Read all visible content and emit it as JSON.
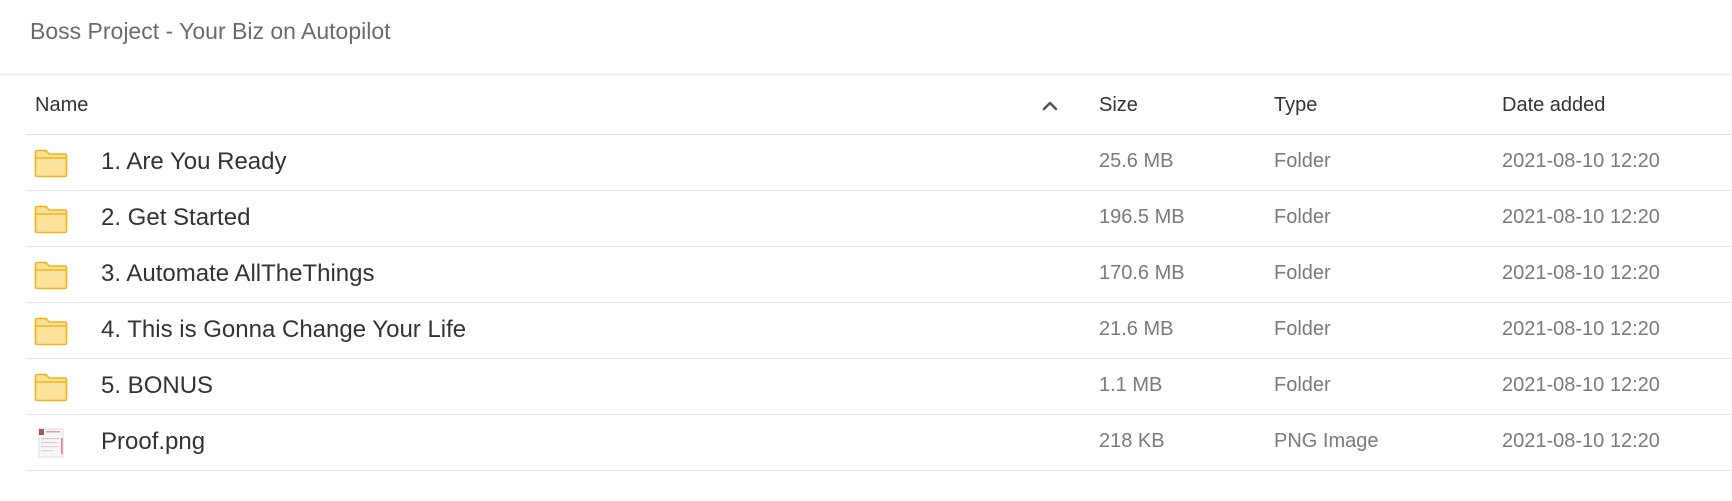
{
  "breadcrumb": {
    "title": "Boss Project - Your Biz on Autopilot"
  },
  "table": {
    "headers": {
      "name": "Name",
      "size": "Size",
      "type": "Type",
      "date": "Date added"
    },
    "sort": {
      "column": "name",
      "direction": "ascending",
      "icon": "chevron-up-icon"
    },
    "rows": [
      {
        "name": "1. Are You Ready",
        "size": "25.6 MB",
        "type": "Folder",
        "date": "2021-08-10 12:20",
        "icon": "folder-icon"
      },
      {
        "name": "2. Get Started",
        "size": "196.5 MB",
        "type": "Folder",
        "date": "2021-08-10 12:20",
        "icon": "folder-icon"
      },
      {
        "name": "3. Automate AllTheThings",
        "size": "170.6 MB",
        "type": "Folder",
        "date": "2021-08-10 12:20",
        "icon": "folder-icon"
      },
      {
        "name": "4. This is Gonna Change Your Life",
        "size": "21.6 MB",
        "type": "Folder",
        "date": "2021-08-10 12:20",
        "icon": "folder-icon"
      },
      {
        "name": "5. BONUS",
        "size": "1.1 MB",
        "type": "Folder",
        "date": "2021-08-10 12:20",
        "icon": "folder-icon"
      },
      {
        "name": "Proof.png",
        "size": "218 KB",
        "type": "PNG Image",
        "date": "2021-08-10 12:20",
        "icon": "image-thumbnail-icon"
      }
    ]
  },
  "colors": {
    "folder_fill": "#fde29b",
    "folder_stroke": "#f2b418",
    "divider": "#e8e8e8",
    "primary_text": "#333333",
    "secondary_text": "#7a7a7a"
  }
}
